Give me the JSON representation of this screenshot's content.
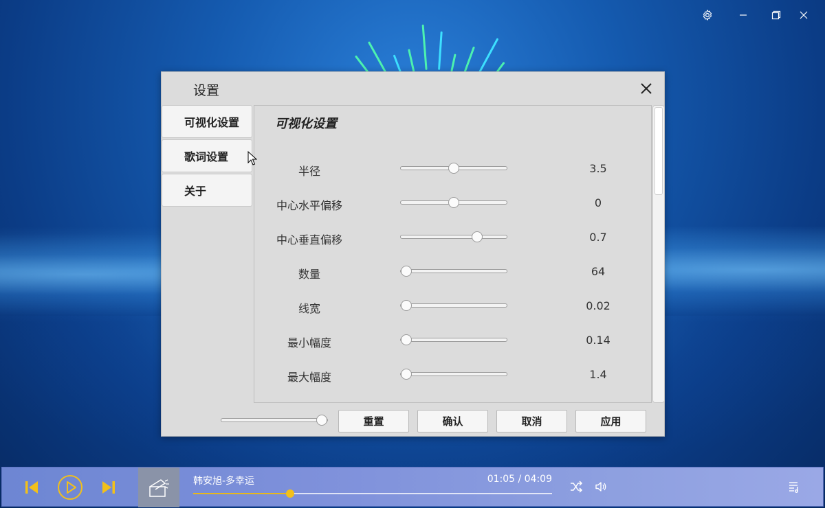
{
  "window": {
    "settings_icon": "gear-icon",
    "restore_icon": "restore-window-icon",
    "minimize_icon": "minimize-icon",
    "close_icon": "close-icon"
  },
  "dialog": {
    "title": "设置",
    "close_icon": "close-icon",
    "nav": [
      {
        "label": "可视化设置"
      },
      {
        "label": "歌词设置"
      },
      {
        "label": "关于"
      }
    ],
    "section_title": "可视化设置",
    "rows": [
      {
        "label": "半径",
        "value": "3.5",
        "position": 0.5
      },
      {
        "label": "中心水平偏移",
        "value": "0",
        "position": 0.5
      },
      {
        "label": "中心垂直偏移",
        "value": "0.7",
        "position": 0.72
      },
      {
        "label": "数量",
        "value": "64",
        "position": 0.05
      },
      {
        "label": "线宽",
        "value": "0.02",
        "position": 0.05
      },
      {
        "label": "最小幅度",
        "value": "0.14",
        "position": 0.05
      },
      {
        "label": "最大幅度",
        "value": "1.4",
        "position": 0.05
      }
    ],
    "bottom_slider_position": 0.95,
    "buttons": {
      "reset": "重置",
      "confirm": "确认",
      "cancel": "取消",
      "apply": "应用"
    }
  },
  "player": {
    "song": "韩安旭-多幸运",
    "time": "01:05 / 04:09",
    "progress": 0.27,
    "prev_icon": "skip-previous-icon",
    "play_icon": "play-icon",
    "next_icon": "skip-next-icon",
    "shuffle_icon": "shuffle-icon",
    "volume_icon": "volume-icon",
    "playlist_icon": "playlist-icon"
  },
  "colors": {
    "accent": "#f2c01a",
    "player_bar": "#7f91db",
    "dialog_bg": "#dcdcdc"
  }
}
